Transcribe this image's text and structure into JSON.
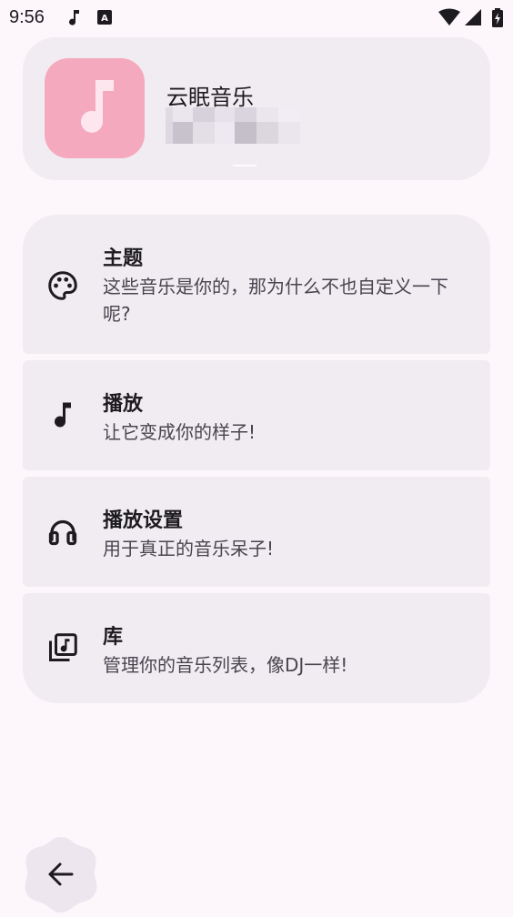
{
  "status_bar": {
    "time": "9:56",
    "icons": [
      "music-note-icon",
      "keyboard-a-icon",
      "wifi-icon",
      "signal-icon",
      "battery-charging-icon"
    ]
  },
  "app_header": {
    "name": "云眠音乐",
    "icon": "music-note-icon",
    "icon_color": "#f5a9bf"
  },
  "settings": [
    {
      "title": "主题",
      "description": "这些音乐是你的，那为什么不也自定义一下呢?",
      "icon": "palette-icon"
    },
    {
      "title": "播放",
      "description": "让它变成你的样子!",
      "icon": "music-note-icon"
    },
    {
      "title": "播放设置",
      "description": "用于真正的音乐呆子!",
      "icon": "headphones-icon"
    },
    {
      "title": "库",
      "description": "管理你的音乐列表，像DJ一样!",
      "icon": "library-music-icon"
    }
  ],
  "navigation": {
    "back_icon": "arrow-back-icon"
  },
  "colors": {
    "background": "#fdf7fc",
    "card": "#f1ecf2",
    "accent": "#f5a9bf",
    "text_primary": "#1d1b20",
    "text_secondary": "#49454f"
  }
}
